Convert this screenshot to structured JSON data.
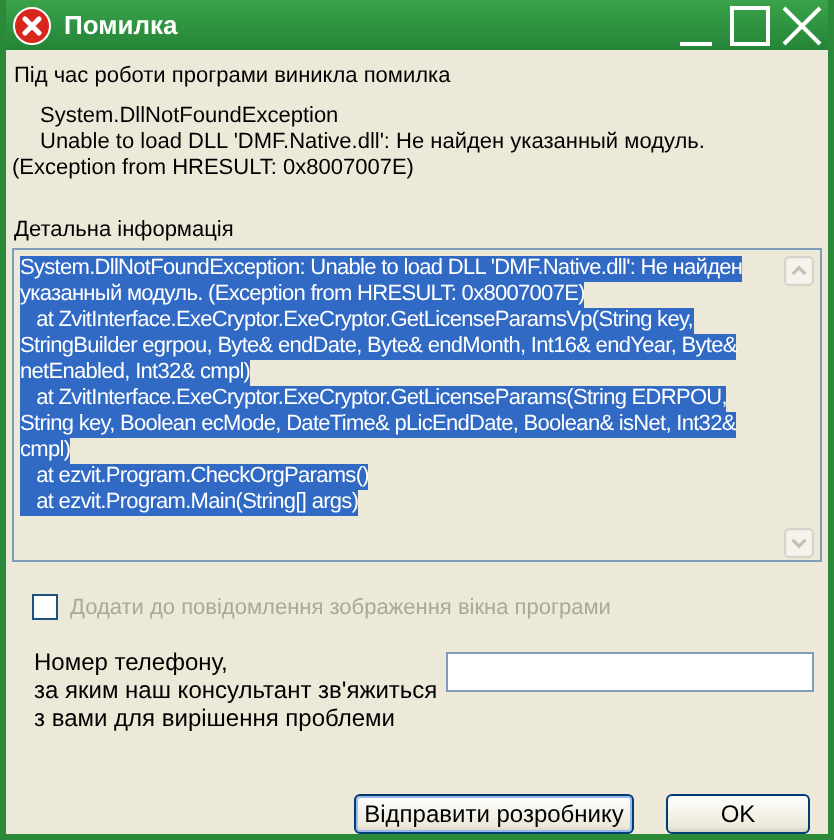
{
  "window": {
    "title": "Помилка"
  },
  "message": "Під час роботи програми виникла помилка",
  "error_lines": [
    "System.DllNotFoundException",
    "Unable to load DLL 'DMF.Native.dll': Не найден указанный модуль."
  ],
  "hresult": "(Exception from HRESULT: 0x8007007E)",
  "details_label": "Детальна інформація",
  "details_lines": [
    {
      "text": "System.DllNotFoundException: Unable to load DLL 'DMF.Native.dll': Не найден",
      "selected": true
    },
    {
      "text": "указанный модуль. (Exception from HRESULT: 0x8007007E)",
      "selected": true
    },
    {
      "text": "   at ZvitInterface.ExeCryptor.ExeCryptor.GetLicenseParamsVp(String key,",
      "selected": true
    },
    {
      "text": "StringBuilder egrpou, Byte& endDate, Byte& endMonth, Int16& endYear, Byte&",
      "selected": true
    },
    {
      "text": "netEnabled, Int32& cmpl)",
      "selected": true
    },
    {
      "text": "   at ZvitInterface.ExeCryptor.ExeCryptor.GetLicenseParams(String EDRPOU,",
      "selected": true
    },
    {
      "text": "String key, Boolean ecMode, DateTime& pLicEndDate, Boolean& isNet, Int32&",
      "selected": true
    },
    {
      "text": "cmpl)",
      "selected": true
    },
    {
      "text": "   at ezvit.Program.CheckOrgParams()",
      "selected": true
    },
    {
      "text": "   at ezvit.Program.Main(String[] args)",
      "selected": true
    }
  ],
  "attach_screenshot": {
    "label": "Додати до повідомлення зображення вікна програми",
    "checked": false,
    "disabled": true
  },
  "phone": {
    "label_lines": [
      "Номер телефону,",
      "за яким наш консультант зв'яжиться",
      "з вами для вирішення проблеми"
    ]
  },
  "buttons": [
    "Відправити розробнику",
    "OK"
  ]
}
